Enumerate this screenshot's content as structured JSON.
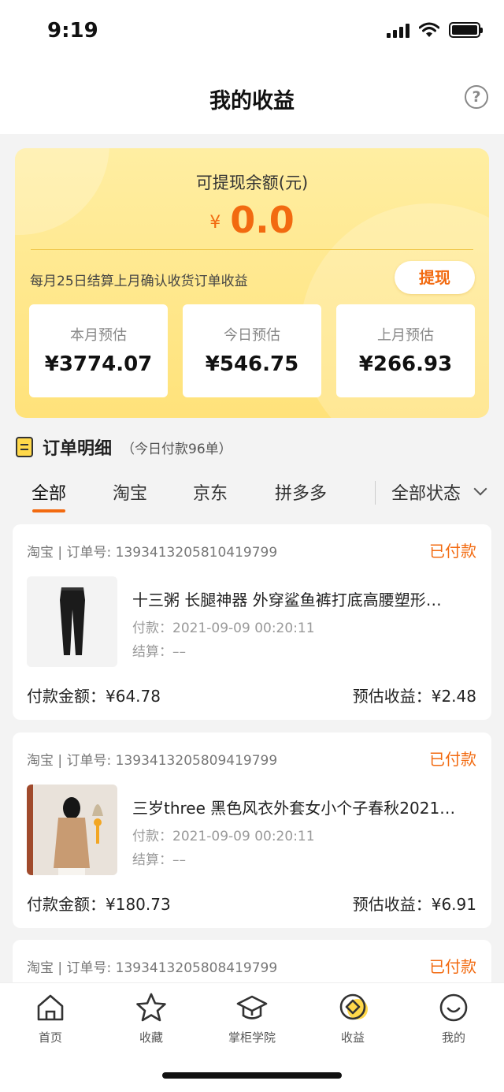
{
  "status_bar": {
    "time": "9:19"
  },
  "nav": {
    "title": "我的收益",
    "help_glyph": "?"
  },
  "balance": {
    "label": "可提现余额(元)",
    "currency": "¥",
    "value": "0.0",
    "settle_note": "每月25日结算上月确认收货订单收益",
    "withdraw_label": "提现",
    "stats": [
      {
        "label": "本月预估",
        "value": "¥3774.07"
      },
      {
        "label": "今日预估",
        "value": "¥546.75"
      },
      {
        "label": "上月预估",
        "value": "¥266.93"
      }
    ]
  },
  "orders_section": {
    "title": "订单明细",
    "count_text": "（今日付款96单）",
    "tabs": [
      "全部",
      "淘宝",
      "京东",
      "拼多多"
    ],
    "active_tab": "全部",
    "status_filter": "全部状态"
  },
  "orders": [
    {
      "platform_line": "淘宝 | 订单号:  1393413205810419799",
      "status": "已付款",
      "name": "十三粥 长腿神器 外穿鲨鱼裤打底高腰塑形…",
      "pay_time": "付款：2021-09-09 00:20:11",
      "settle": "结算：––",
      "amount": "付款金额：¥64.78",
      "estimate": "预估收益：¥2.48"
    },
    {
      "platform_line": "淘宝 | 订单号:  1393413205809419799",
      "status": "已付款",
      "name": "三岁three 黑色风衣外套女小个子春秋2021…",
      "pay_time": "付款：2021-09-09 00:20:11",
      "settle": "结算：––",
      "amount": "付款金额：¥180.73",
      "estimate": "预估收益：¥6.91"
    },
    {
      "platform_line": "淘宝 | 订单号:  1393413205808419799",
      "status": "已付款"
    }
  ],
  "tabbar": [
    {
      "label": "首页",
      "icon": "home-icon"
    },
    {
      "label": "收藏",
      "icon": "star-icon"
    },
    {
      "label": "掌柜学院",
      "icon": "graduation-cap-icon"
    },
    {
      "label": "收益",
      "icon": "earnings-icon",
      "active": true
    },
    {
      "label": "我的",
      "icon": "smile-icon"
    }
  ],
  "colors": {
    "accent": "#f26a10",
    "card_yellow": "#ffe27a",
    "active_dot": "#ffd84a"
  }
}
